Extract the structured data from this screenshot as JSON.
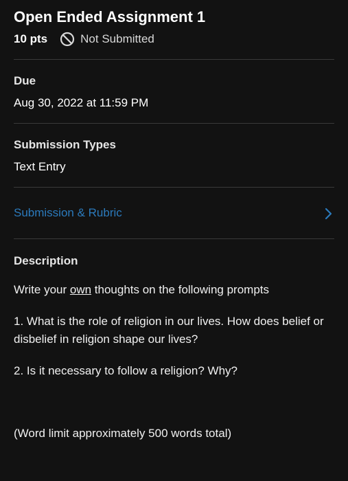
{
  "assignment": {
    "title": "Open Ended Assignment 1",
    "points": "10 pts",
    "status": "Not Submitted",
    "status_icon": "no-entry-circle-icon"
  },
  "details": {
    "due_label": "Due",
    "due_value": "Aug 30, 2022 at 11:59 PM",
    "types_label": "Submission Types",
    "types_value": "Text Entry"
  },
  "submission_link": {
    "label": "Submission & Rubric",
    "color": "#2b7abc",
    "icon": "chevron-right-icon"
  },
  "description": {
    "label": "Description",
    "intro_before": "Write your ",
    "intro_underlined": "own",
    "intro_after": " thoughts on the following prompts",
    "prompt1": "1. What is the role of religion in our lives. How does belief or disbelief in religion shape our lives?",
    "prompt2": "2. Is it necessary to follow a religion? Why?",
    "word_limit": "(Word limit approximately 500 words total)"
  },
  "colors": {
    "background": "#121212",
    "divider": "#3a3a3a",
    "link": "#2b7abc"
  }
}
